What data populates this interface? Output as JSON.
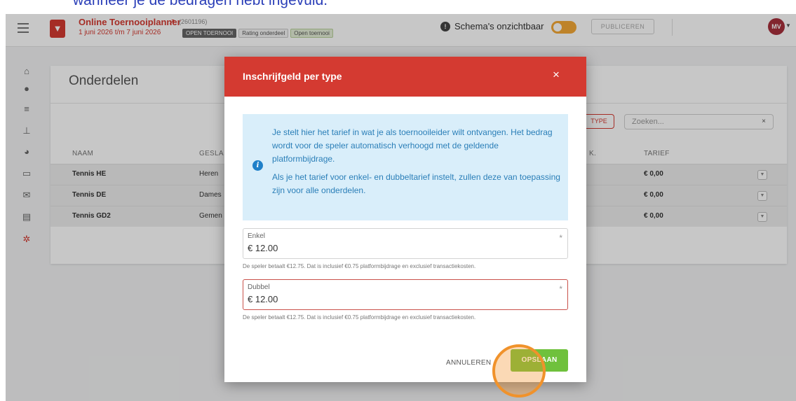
{
  "caption": "wanneer je de bedragen hebt ingevuld.",
  "header": {
    "menu_icon": "hamburger-icon",
    "tournament_name": "Online Toernooiplanner",
    "external_icon": "external-link-icon",
    "tournament_id": "(2601196)",
    "dates": "1 juni 2026 t/m 7 juni 2026",
    "badges": [
      "OPEN TOERNOOI",
      "Rating onderdeel",
      "Open toernooi"
    ],
    "schema_label": "Schema's onzichtbaar",
    "publish_label": "PUBLICEREN",
    "avatar_initials": "MV"
  },
  "sidebar": {
    "icons": [
      "home-icon",
      "users-icon",
      "list-icon",
      "sitemap-icon",
      "ball-icon",
      "monitor-icon",
      "mail-icon",
      "documents-icon",
      "gear-icon"
    ],
    "active_color": "#d43a31"
  },
  "page": {
    "title": "Onderdelen",
    "type_button": "TYPE",
    "search_placeholder": "Zoeken...",
    "search_clear": "×",
    "columns": {
      "name": "NAAM",
      "gender": "GESLA",
      "max": "K.",
      "fee": "TARIEF"
    },
    "rows": [
      {
        "name": "Tennis HE",
        "gender": "Heren",
        "fee": "€ 0,00"
      },
      {
        "name": "Tennis DE",
        "gender": "Dames",
        "fee": "€ 0,00"
      },
      {
        "name": "Tennis GD2",
        "gender": "Gemen",
        "fee": "€ 0,00"
      }
    ]
  },
  "modal": {
    "title": "Inschrijfgeld per type",
    "close": "×",
    "info_paragraph_1": "Je stelt hier het tarief in wat je als toernooileider wilt ontvangen. Het bedrag wordt voor de speler automatisch verhoogd met de geldende platformbijdrage.",
    "info_paragraph_2": "Als je het tarief voor enkel- en dubbeltarief instelt, zullen deze van toepassing zijn voor alle onderdelen.",
    "fields": [
      {
        "label": "Enkel",
        "value": "€ 12.00",
        "required": "*",
        "hint": "De speler betaalt €12.75. Dat is inclusief €0.75 platformbijdrage en exclusief transactiekosten."
      },
      {
        "label": "Dubbel",
        "value": "€ 12.00",
        "required": "*",
        "hint": "De speler betaalt €12.75. Dat is inclusief €0.75 platformbijdrage en exclusief transactiekosten."
      }
    ],
    "cancel_label": "ANNULEREN",
    "save_label": "OPSLAAN"
  },
  "colors": {
    "brand_red": "#d43a31",
    "save_green": "#6fc13c",
    "info_blue": "#2b7fb8",
    "highlight_orange": "#f0922b"
  }
}
